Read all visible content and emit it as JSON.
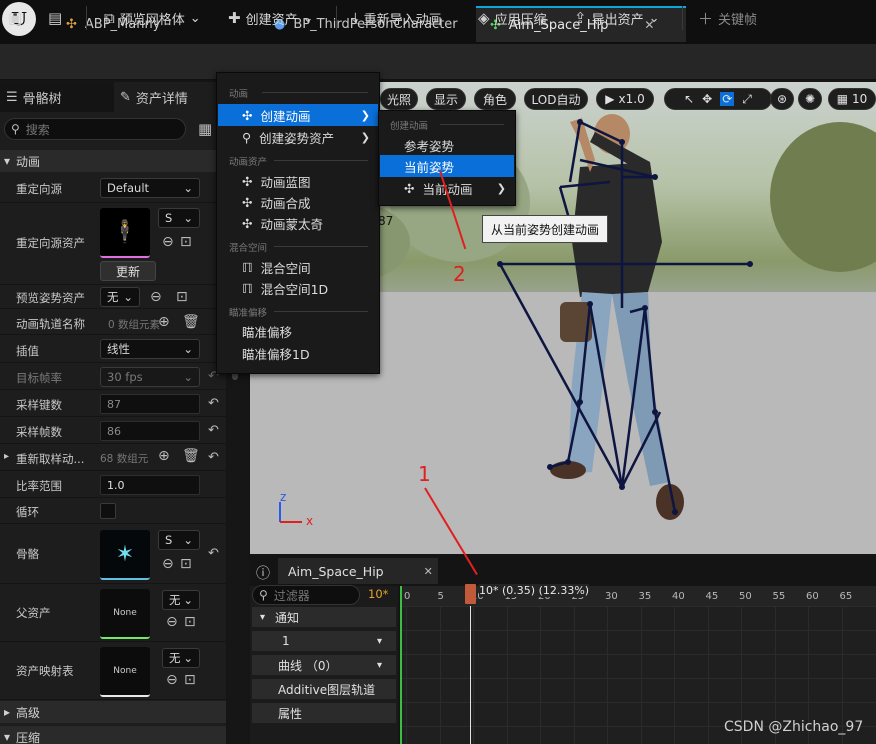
{
  "tabs": [
    {
      "label": "ABP_Manny"
    },
    {
      "label": "BP_ThirdPersonCharacter"
    },
    {
      "label": "Aim_Space_Hip",
      "close": "✕"
    }
  ],
  "toolbar": {
    "preview_mesh": "预览网格体",
    "create_asset": "创建资产",
    "reimport": "重新导入动画",
    "apply_compression": "应用压缩",
    "export_asset": "导出资产",
    "keyframe": "关键帧"
  },
  "panel_tabs": {
    "skeleton_tree": "骨骼树",
    "asset_details": "资产详情"
  },
  "search_placeholder": "搜索",
  "sections": {
    "animation": "动画",
    "advanced": "高级",
    "compression": "压缩"
  },
  "props": {
    "retarget_source": {
      "label": "重定向源",
      "value": "Default"
    },
    "retarget_source_asset": {
      "label": "重定向源资产",
      "value": "S",
      "button": "更新"
    },
    "preview_pose_asset": {
      "label": "预览姿势资产",
      "value": "无"
    },
    "anim_track_names": {
      "label": "动画轨道名称",
      "value": "0 数组元素"
    },
    "interpolation": {
      "label": "插值",
      "value": "线性"
    },
    "target_frame_rate": {
      "label": "目标帧率",
      "value": "30 fps"
    },
    "sampled_keys": {
      "label": "采样键数",
      "value": "87"
    },
    "sampled_frames": {
      "label": "采样帧数",
      "value": "86"
    },
    "resample_anim": {
      "label": "重新取样动...",
      "value": "68 数组元"
    },
    "rate_scale": {
      "label": "比率范围",
      "value": "1.0"
    },
    "loop": {
      "label": "循环"
    },
    "skeleton": {
      "label": "骨骼",
      "value": "S"
    },
    "parent_asset": {
      "label": "父资产",
      "value": "无",
      "thumb": "None"
    },
    "asset_mapping": {
      "label": "资产映射表",
      "value": "无",
      "thumb": "None"
    }
  },
  "viewport": {
    "lit": "光照",
    "show": "显示",
    "character": "角色",
    "lod": "LOD自动",
    "speed": "x1.0",
    "grid_size": "10",
    "axis_z": "z",
    "axis_x": "x",
    "partial_text": "87"
  },
  "create_menu": {
    "heading_anim": "动画",
    "create_animation": "创建动画",
    "create_pose_asset": "创建姿势资产",
    "heading_anim_asset": "动画资产",
    "anim_blueprint": "动画蓝图",
    "anim_composite": "动画合成",
    "anim_montage": "动画蒙太奇",
    "heading_blend_space": "混合空间",
    "blend_space": "混合空间",
    "blend_space_1d": "混合空间1D",
    "heading_aim_offset": "瞄准偏移",
    "aim_offset": "瞄准偏移",
    "aim_offset_1d": "瞄准偏移1D"
  },
  "submenu": {
    "heading": "创建动画",
    "reference_pose": "参考姿势",
    "current_pose": "当前姿势",
    "current_animation": "当前动画"
  },
  "tooltip": "从当前姿势创建动画",
  "timeline": {
    "tab": "Aim_Space_Hip",
    "tab_close": "✕",
    "filter_placeholder": "过滤器",
    "fps_badge": "10*",
    "scrub_label": "10* (0.35) (12.33%)",
    "ticks": [
      "0",
      "5",
      "10",
      "15",
      "20",
      "25",
      "30",
      "35",
      "40",
      "45",
      "50",
      "55",
      "60",
      "65"
    ],
    "tracks": {
      "notifies": "通知",
      "notify_1": "1",
      "curves": "曲线 （0）",
      "additive": "Additive图层轨道",
      "attributes": "属性"
    }
  },
  "annotations": {
    "one": "1",
    "two": "2"
  },
  "watermark": "CSDN @Zhichao_97",
  "colors": {
    "accent": "#0a6fd8",
    "annotation": "#e02020",
    "skeleton": "#0d1540"
  }
}
